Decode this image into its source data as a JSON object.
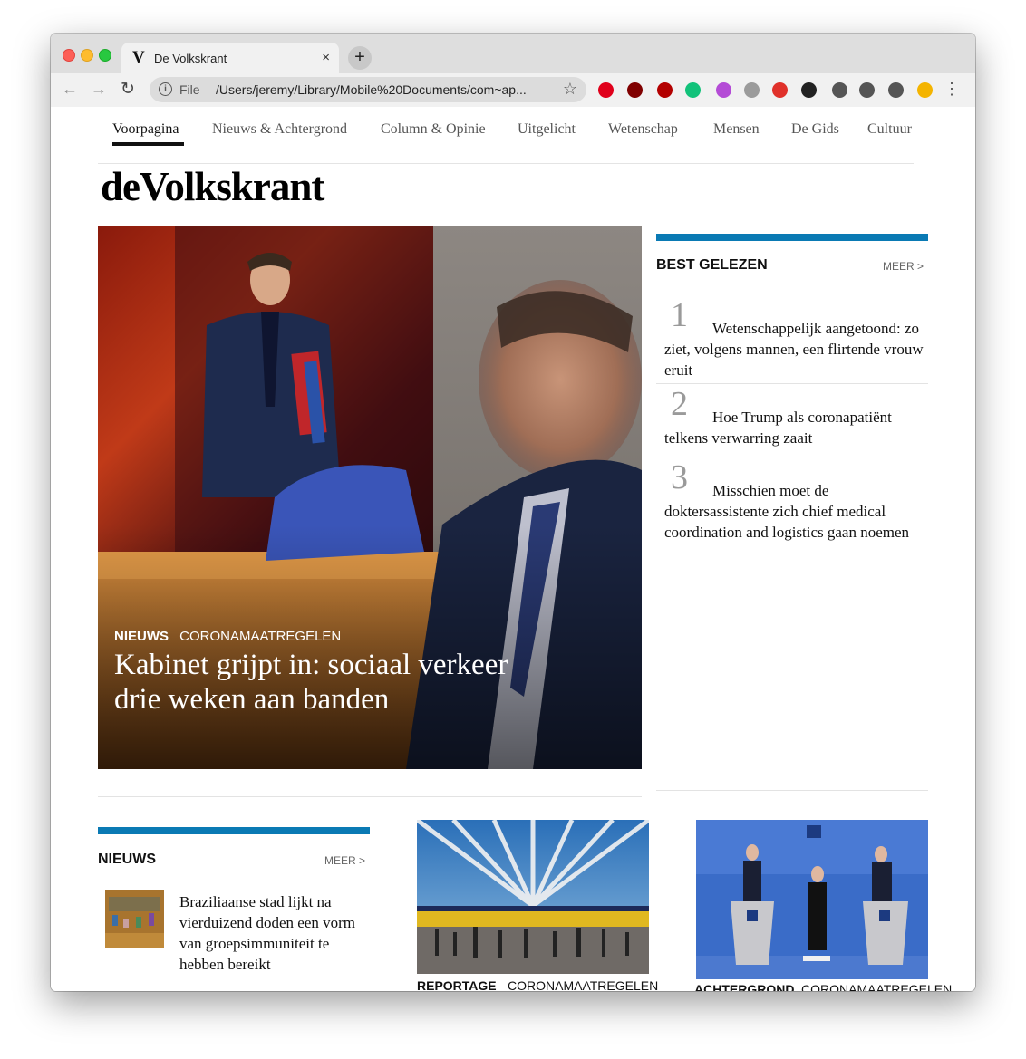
{
  "browser": {
    "tab_title": "De Volkskrant",
    "tab_favicon": "V",
    "tab_close": "×",
    "new_tab": "+",
    "address_scheme": "File",
    "address_url": "/Users/jeremy/Library/Mobile%20Documents/com~ap...",
    "extensions": [
      {
        "icon": "opera-icon",
        "color": "#e0001b"
      },
      {
        "icon": "ublock-icon",
        "color": "#800000"
      },
      {
        "icon": "ublock-origin-icon",
        "color": "#b30000"
      },
      {
        "icon": "bird-icon",
        "color": "#12c27a"
      },
      {
        "icon": "color-wheel-icon",
        "color": "#b44bd6"
      },
      {
        "icon": "translate-icon",
        "color": "#9b9b9b"
      },
      {
        "icon": "tp-icon",
        "color": "#e0312a"
      },
      {
        "icon": "notion-icon",
        "color": "#222222"
      },
      {
        "icon": "eyedropper-icon",
        "color": "#555555"
      },
      {
        "icon": "puzzle-icon",
        "color": "#555555"
      },
      {
        "icon": "media-queue-icon",
        "color": "#555555"
      },
      {
        "icon": "profile-avatar-icon",
        "color": "#f4b400"
      }
    ]
  },
  "site": {
    "nav": [
      {
        "label": "Voorpagina",
        "active": true
      },
      {
        "label": "Nieuws & Achtergrond",
        "active": false
      },
      {
        "label": "Column & Opinie",
        "active": false
      },
      {
        "label": "Uitgelicht",
        "active": false
      },
      {
        "label": "Wetenschap",
        "active": false
      },
      {
        "label": "Mensen",
        "active": false
      },
      {
        "label": "De Gids",
        "active": false
      },
      {
        "label": "Cultuur",
        "active": false
      }
    ],
    "logo": "deVolkskrant",
    "accent": "#0a7ab4"
  },
  "hero": {
    "tag": "NIEUWS",
    "category": "CORONAMAATREGELEN",
    "headline": "Kabinet grijpt in: sociaal verkeer drie weken aan banden"
  },
  "best_gelezen": {
    "title": "BEST GELEZEN",
    "more": "MEER >",
    "items": [
      {
        "rank": "1",
        "text": "Wetenschappelijk aangetoond: zo ziet, volgens mannen, een flirtende vrouw eruit"
      },
      {
        "rank": "2",
        "text": "Hoe Trump als coronapatiënt telkens verwarring zaait"
      },
      {
        "rank": "3",
        "text": "Misschien moet de doktersassistente zich chief medical coordination and logistics gaan noemen"
      }
    ]
  },
  "nieuws": {
    "title": "NIEUWS",
    "more": "MEER >",
    "item_text": "Braziliaanse stad lijkt na vierduizend doden een vorm van groepsimmuniteit te hebben bereikt"
  },
  "cards": [
    {
      "tag": "REPORTAGE",
      "category": "CORONAMAATREGELEN"
    },
    {
      "tag": "ACHTERGROND",
      "category": "CORONAMAATREGELEN"
    }
  ]
}
